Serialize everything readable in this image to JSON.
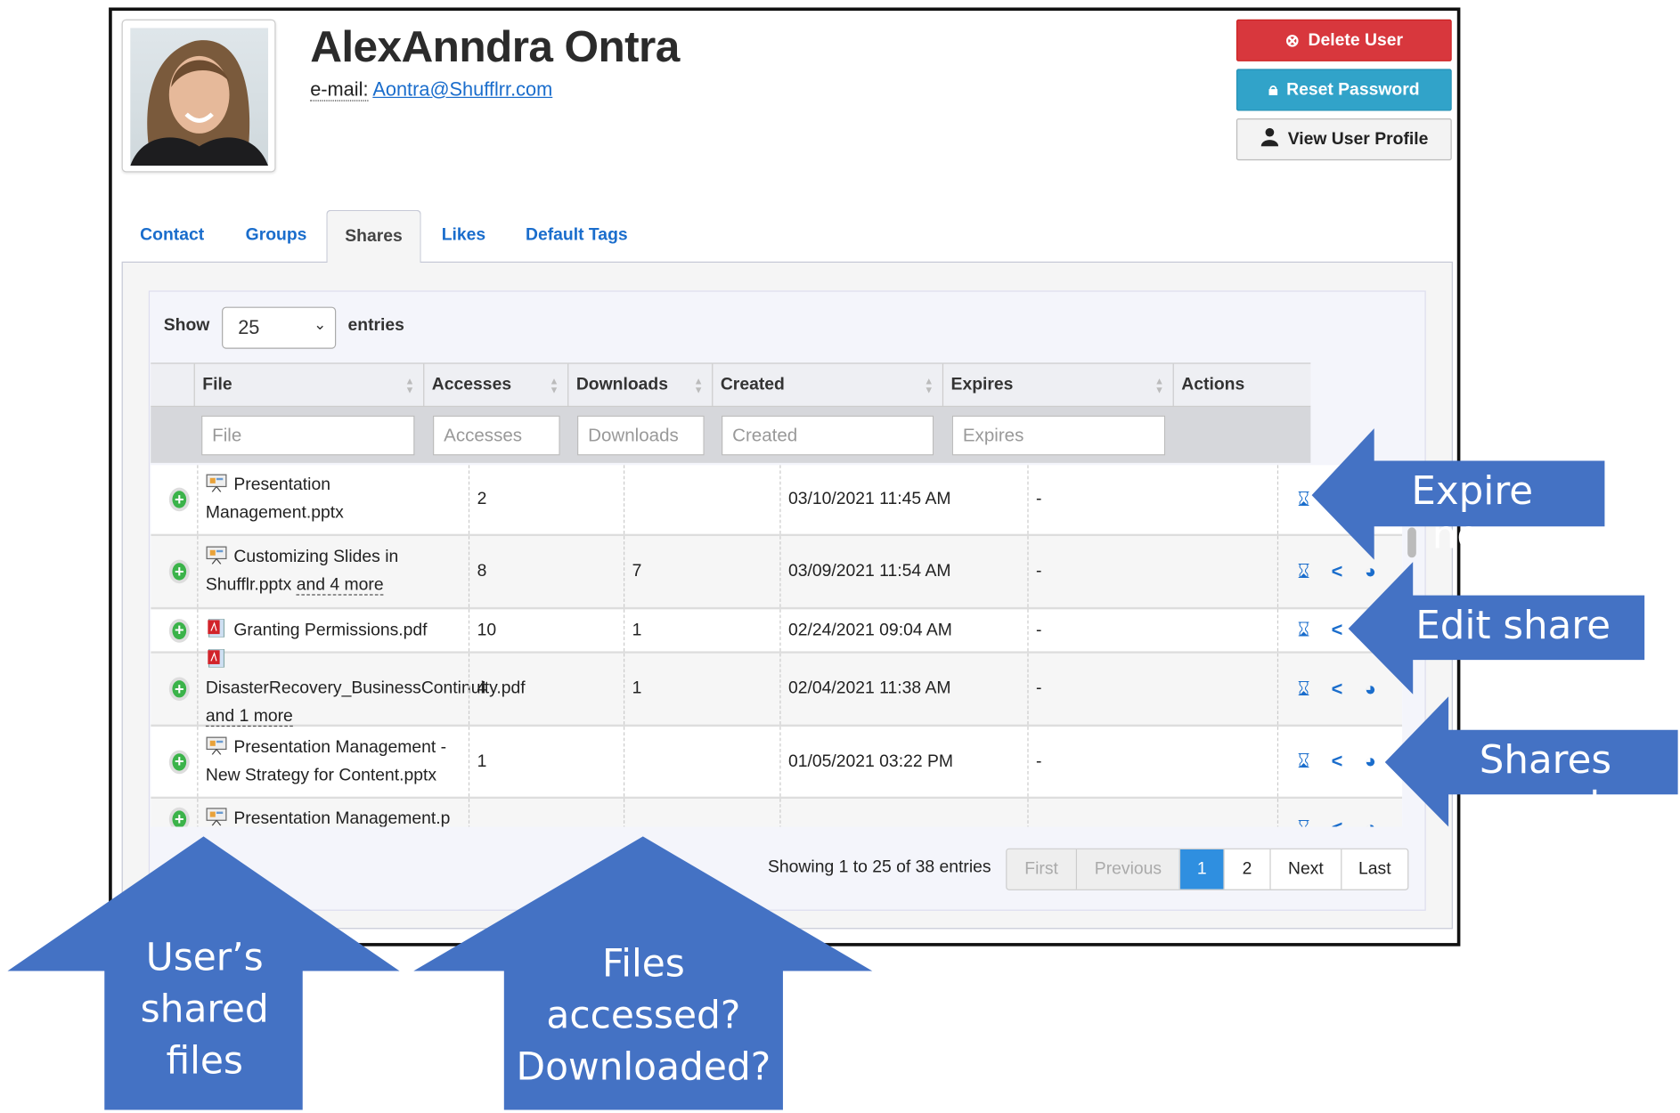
{
  "user": {
    "name": "AlexAnndra Ontra",
    "email_label": "e-mail:",
    "email": "Aontra@Shufflrr.com"
  },
  "actions": {
    "delete": "Delete User",
    "reset": "Reset Password",
    "view": "View User Profile"
  },
  "tabs": [
    {
      "label": "Contact"
    },
    {
      "label": "Groups"
    },
    {
      "label": "Shares",
      "active": true
    },
    {
      "label": "Likes"
    },
    {
      "label": "Default Tags"
    }
  ],
  "table": {
    "show_label": "Show",
    "page_size": "25",
    "entries_label": "entries",
    "columns": [
      "File",
      "Accesses",
      "Downloads",
      "Created",
      "Expires",
      "Actions"
    ],
    "filters": [
      "File",
      "Accesses",
      "Downloads",
      "Created",
      "Expires"
    ],
    "rows": [
      {
        "type": "pptx",
        "file": "Presentation Management.pptx",
        "more": "",
        "accesses": "2",
        "downloads": "",
        "created": "03/10/2021 11:45 AM",
        "expires": "-",
        "actions": [
          "expire"
        ]
      },
      {
        "type": "pptx",
        "file": "Customizing Slides in Shufflr.pptx",
        "more": "and 4 more",
        "accesses": "8",
        "downloads": "7",
        "created": "03/09/2021 11:54 AM",
        "expires": "-",
        "actions": [
          "expire",
          "share",
          "report"
        ]
      },
      {
        "type": "pdf",
        "file": "Granting Permissions.pdf",
        "more": "",
        "accesses": "10",
        "downloads": "1",
        "created": "02/24/2021 09:04 AM",
        "expires": "-",
        "actions": [
          "expire",
          "share"
        ]
      },
      {
        "type": "pdf",
        "file": "DisasterRecovery_BusinessContinuity.pdf",
        "more": "and 1 more",
        "accesses": "4",
        "downloads": "1",
        "created": "02/04/2021 11:38 AM",
        "expires": "-",
        "actions": [
          "expire",
          "share",
          "report"
        ]
      },
      {
        "type": "pptx",
        "file": "Presentation Management - New Strategy for Content.pptx",
        "more": "",
        "accesses": "1",
        "downloads": "",
        "created": "01/05/2021 03:22 PM",
        "expires": "-",
        "actions": [
          "expire",
          "share",
          "report"
        ]
      },
      {
        "type": "pptx",
        "file": "Presentation Management.p",
        "more": "",
        "accesses": "",
        "downloads": "",
        "created": "",
        "expires": "",
        "actions": [
          "expire",
          "share",
          "report"
        ]
      }
    ],
    "showing": "Showing 1 to 25 of 38 entries",
    "pagination": {
      "first": "First",
      "previous": "Previous",
      "pages": [
        "1",
        "2"
      ],
      "current": "1",
      "next": "Next",
      "last": "Last"
    }
  },
  "callouts": {
    "expire": "Expire now",
    "edit": "Edit share",
    "report": "Shares report",
    "files": "User’s shared files",
    "accessed": "Files accessed? Downloaded?"
  },
  "colors": {
    "callout": "#4472c4",
    "delete": "#d8373d",
    "reset": "#31a3c9",
    "link": "#1a6dcc"
  }
}
